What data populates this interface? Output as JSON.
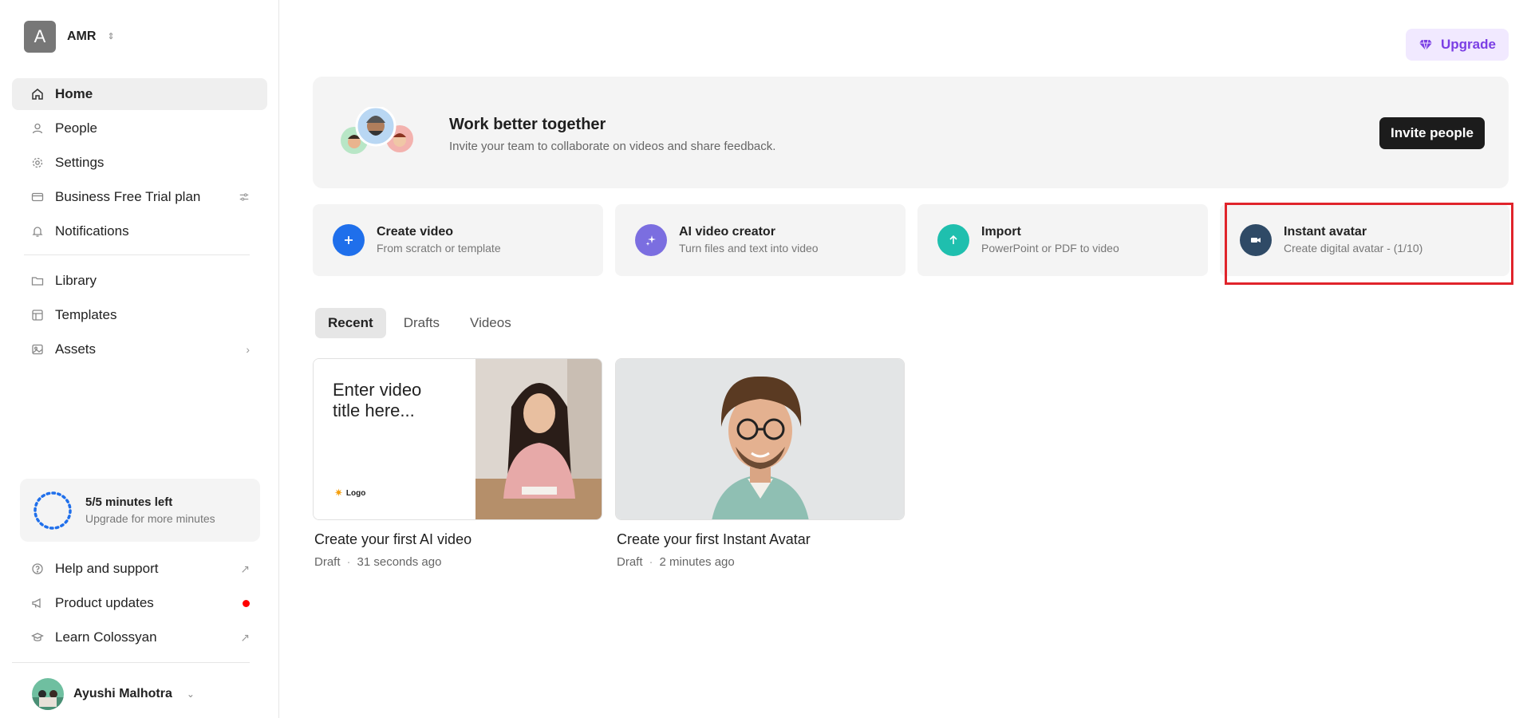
{
  "workspace": {
    "initial": "A",
    "name": "AMR"
  },
  "nav_primary": [
    {
      "id": "home",
      "label": "Home",
      "icon": "home-icon",
      "active": true
    },
    {
      "id": "people",
      "label": "People",
      "icon": "person-icon"
    },
    {
      "id": "settings",
      "label": "Settings",
      "icon": "gear-icon"
    },
    {
      "id": "plan",
      "label": "Business Free Trial plan",
      "icon": "card-icon",
      "trail": "sliders-icon"
    },
    {
      "id": "notifications",
      "label": "Notifications",
      "icon": "bell-icon"
    }
  ],
  "nav_secondary": [
    {
      "id": "library",
      "label": "Library",
      "icon": "folder-icon"
    },
    {
      "id": "templates",
      "label": "Templates",
      "icon": "template-icon"
    },
    {
      "id": "assets",
      "label": "Assets",
      "icon": "image-icon",
      "trail": "chevron-right-icon"
    }
  ],
  "minutes": {
    "title": "5/5 minutes left",
    "subtitle": "Upgrade for more minutes"
  },
  "nav_footer": [
    {
      "id": "help",
      "label": "Help and support",
      "icon": "help-icon",
      "trail": "external-link-icon"
    },
    {
      "id": "updates",
      "label": "Product updates",
      "icon": "megaphone-icon",
      "trail": "notification-dot"
    },
    {
      "id": "learn",
      "label": "Learn Colossyan",
      "icon": "graduation-icon",
      "trail": "external-link-icon"
    }
  ],
  "user": {
    "name": "Ayushi Malhotra"
  },
  "header": {
    "upgrade_label": "Upgrade"
  },
  "banner": {
    "title": "Work better together",
    "subtitle": "Invite your team to collaborate on videos and share feedback.",
    "invite_label": "Invite people"
  },
  "actions": [
    {
      "id": "create-video",
      "title": "Create video",
      "subtitle": "From scratch or template",
      "color": "#1f6feb",
      "icon": "plus-icon"
    },
    {
      "id": "ai-video-creator",
      "title": "AI video creator",
      "subtitle": "Turn files and text into video",
      "color": "#7b6ee0",
      "icon": "sparkle-icon"
    },
    {
      "id": "import",
      "title": "Import",
      "subtitle": "PowerPoint or PDF to video",
      "color": "#1fbfae",
      "icon": "arrow-up-icon"
    },
    {
      "id": "instant-avatar",
      "title": "Instant avatar",
      "subtitle": "Create digital avatar - (1/10)",
      "color": "#2f4a66",
      "icon": "camera-icon"
    }
  ],
  "tabs": [
    {
      "label": "Recent",
      "active": true
    },
    {
      "label": "Drafts"
    },
    {
      "label": "Videos"
    }
  ],
  "cards": [
    {
      "title": "Create your first AI video",
      "status": "Draft",
      "time": "31 seconds ago",
      "thumb_title": "Enter video title here...",
      "thumb_logo": "Logo"
    },
    {
      "title": "Create your first Instant Avatar",
      "status": "Draft",
      "time": "2 minutes ago"
    }
  ]
}
